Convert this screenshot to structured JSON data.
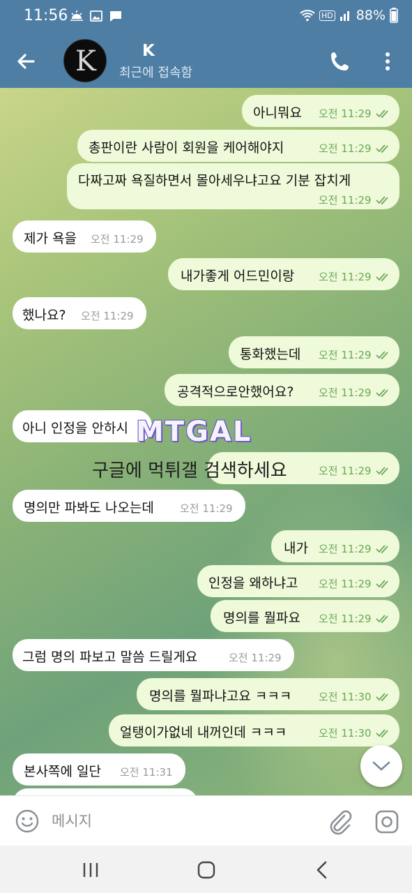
{
  "status_bar": {
    "time": "11:56",
    "battery": "88%",
    "network_badge": "HD",
    "icons": [
      "weather-icon",
      "image-icon",
      "chat-notification-icon",
      "wifi-icon",
      "signal-icon",
      "battery-icon"
    ]
  },
  "header": {
    "avatar_letter": "K",
    "contact_name": "K",
    "status": "최근에 접속함",
    "accent_color": "#4f7ea5"
  },
  "messages": [
    {
      "dir": "out",
      "text": "아니뭐요",
      "time": "오전 11:29"
    },
    {
      "dir": "out",
      "text": "총판이란 사람이 회원을 케어해야지",
      "time": "오전 11:29"
    },
    {
      "dir": "out",
      "text": "다짜고짜 욕질하면서 몰아세우냐고요 기분 잡치게",
      "time": "오전 11:29"
    },
    {
      "dir": "in",
      "text": "제가 욕을",
      "time": "오전 11:29"
    },
    {
      "dir": "out",
      "text": "내가좋게 어드민이랑",
      "time": "오전 11:29"
    },
    {
      "dir": "in",
      "text": "했나요?",
      "time": "오전 11:29"
    },
    {
      "dir": "out",
      "text": "통화했는데",
      "time": "오전 11:29"
    },
    {
      "dir": "out",
      "text": "공격적으로안했어요?",
      "time": "오전 11:29"
    },
    {
      "dir": "in",
      "text": "아니 인정을 안하시",
      "time": ""
    },
    {
      "dir": "out",
      "text": "",
      "time": "오전 11:29"
    },
    {
      "dir": "in",
      "text": "명의만 파봐도 나오는데",
      "time": "오전 11:29"
    },
    {
      "dir": "out",
      "text": "내가",
      "time": "오전 11:29"
    },
    {
      "dir": "out",
      "text": "인정을 왜하냐고",
      "time": "오전 11:29"
    },
    {
      "dir": "out",
      "text": "명의를 뭘파요",
      "time": "오전 11:29"
    },
    {
      "dir": "in",
      "text": "그럼 명의 파보고 말씀 드릴게요",
      "time": "오전 11:29"
    },
    {
      "dir": "out",
      "text": "명의를 뭘파냐고요 ㅋㅋㅋ",
      "time": "오전 11:30"
    },
    {
      "dir": "out",
      "text": "얼탱이가없네 내꺼인데 ㅋㅋㅋ",
      "time": "오전 11:30"
    },
    {
      "dir": "in",
      "text": "본사쪽에 일단",
      "time": "오전 11:31"
    }
  ],
  "watermark": {
    "logo": "MTGAL",
    "subtitle": "구글에 먹튀갤 검색하세요"
  },
  "composer": {
    "placeholder": "메시지"
  },
  "colors": {
    "outgoing_bubble": "#eefad9",
    "incoming_bubble": "#ffffff",
    "read_ticks": "#6aa85a"
  }
}
